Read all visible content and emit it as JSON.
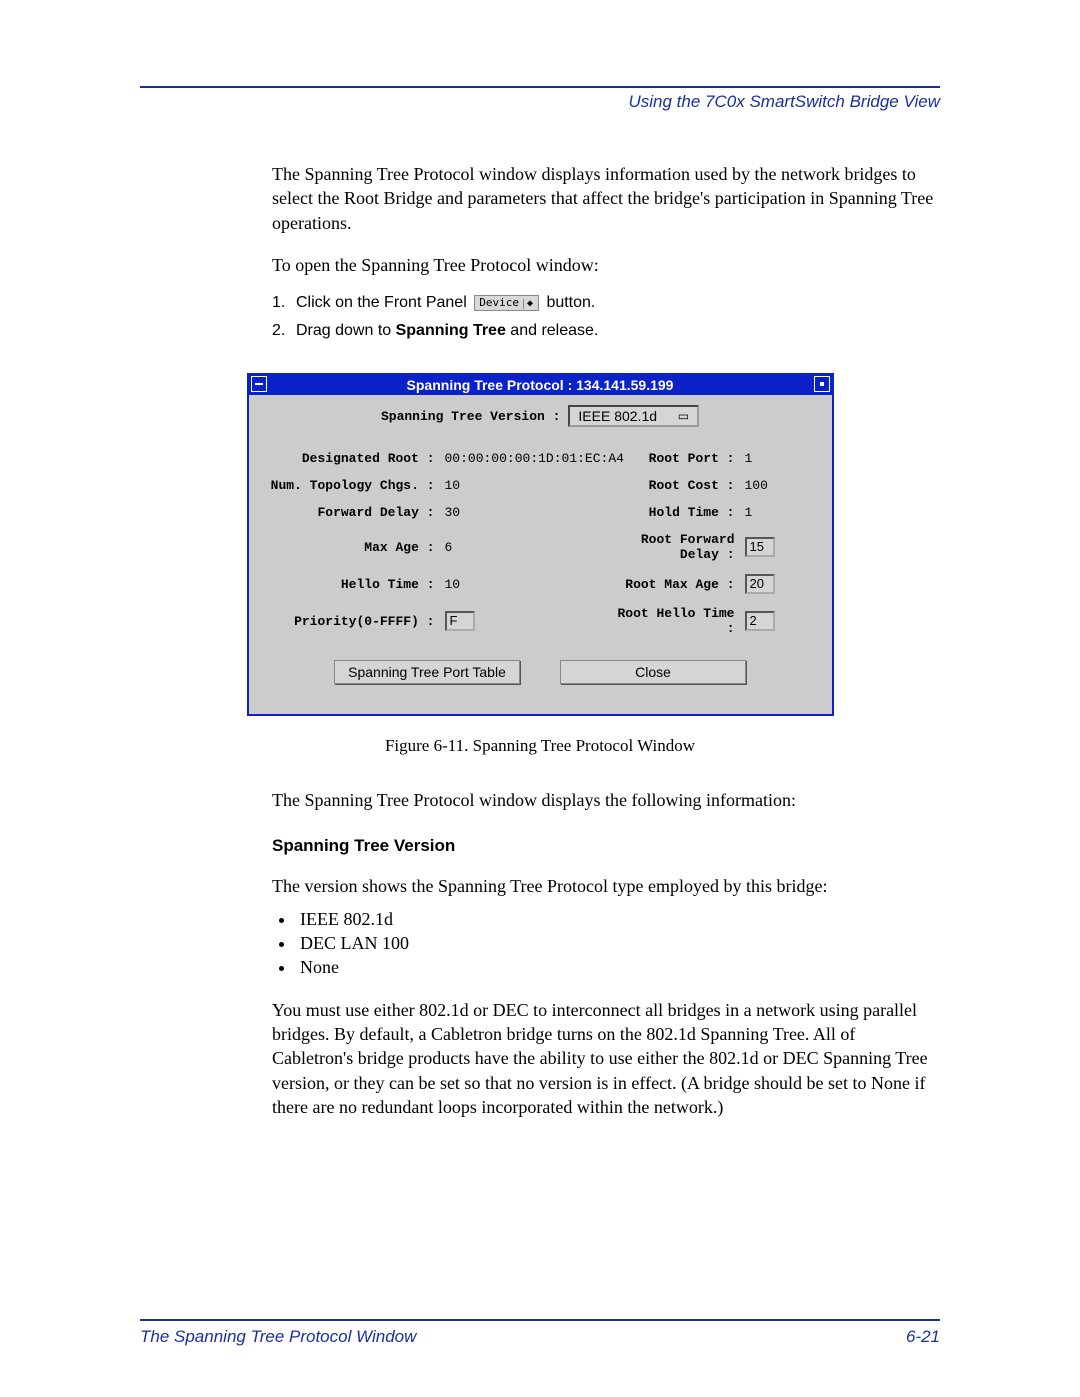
{
  "header": {
    "breadcrumb": "Using the 7C0x SmartSwitch Bridge View"
  },
  "intro": {
    "p1": "The Spanning Tree Protocol window displays information used by the network bridges to select the Root Bridge and parameters that affect the bridge's participation in Spanning Tree operations.",
    "p2": "To open the Spanning Tree Protocol window:"
  },
  "steps": [
    {
      "num": "1.",
      "before": "Click on the Front Panel ",
      "dropdown_label": "Device",
      "after": " button."
    },
    {
      "num": "2.",
      "before": "Drag down to ",
      "bold": "Spanning Tree",
      "after": " and release."
    }
  ],
  "stp_window": {
    "title": "Spanning Tree Protocol : 134.141.59.199",
    "version_label": "Spanning Tree Version :",
    "version_value": "IEEE 802.1d",
    "fields": {
      "designated_root": {
        "label": "Designated Root :",
        "value": "00:00:00:00:1D:01:EC:A4"
      },
      "root_port": {
        "label": "Root Port :",
        "value": "1"
      },
      "num_topology_chgs": {
        "label": "Num. Topology Chgs. :",
        "value": "10"
      },
      "root_cost": {
        "label": "Root Cost :",
        "value": "100"
      },
      "forward_delay": {
        "label": "Forward Delay :",
        "value": "30"
      },
      "hold_time": {
        "label": "Hold Time :",
        "value": "1"
      },
      "max_age": {
        "label": "Max Age :",
        "value": "6"
      },
      "root_forward_delay": {
        "label": "Root Forward Delay :",
        "value": "15"
      },
      "hello_time": {
        "label": "Hello Time :",
        "value": "10"
      },
      "root_max_age": {
        "label": "Root Max Age :",
        "value": "20"
      },
      "priority": {
        "label": "Priority(0-FFFF) :",
        "value": "F"
      },
      "root_hello_time": {
        "label": "Root Hello Time :",
        "value": "2"
      }
    },
    "buttons": {
      "port_table": "Spanning Tree Port Table",
      "close": "Close"
    }
  },
  "caption": "Figure 6-11. Spanning Tree Protocol Window",
  "after": {
    "p1": "The Spanning Tree Protocol window displays the following information:",
    "heading": "Spanning Tree Version",
    "p2": "The version shows the Spanning Tree Protocol type employed by this bridge:",
    "bullets": [
      "IEEE 802.1d",
      "DEC LAN 100",
      "None"
    ],
    "p3": "You must use either 802.1d or DEC to interconnect all bridges in a network using parallel bridges. By default, a Cabletron bridge turns on the 802.1d Spanning Tree. All of Cabletron's bridge products have the ability to use either the 802.1d or DEC Spanning Tree version, or they can be set so that no version is in effect. (A bridge should be set to None if there are no redundant loops incorporated within the network.)"
  },
  "footer": {
    "left": "The Spanning Tree Protocol Window",
    "right": "6-21"
  }
}
